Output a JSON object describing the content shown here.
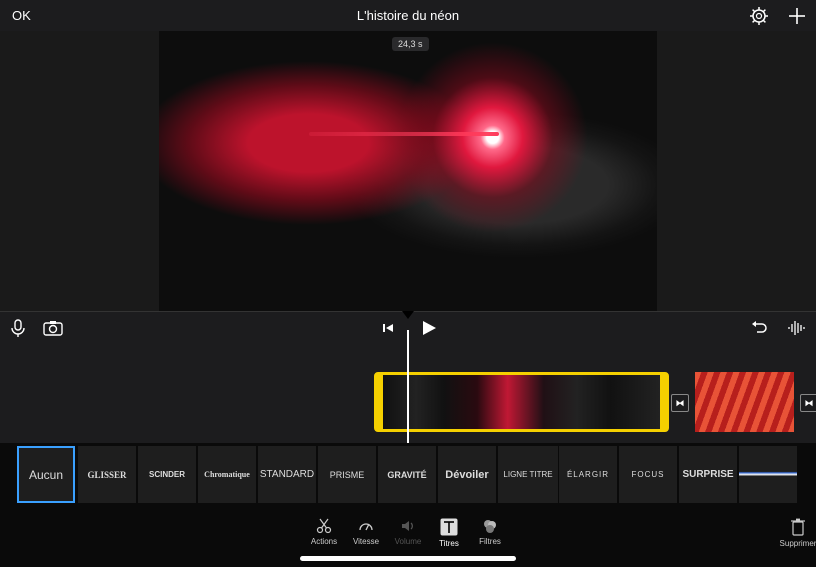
{
  "header": {
    "ok_label": "OK",
    "title": "L'histoire du néon"
  },
  "preview": {
    "duration": "24,3 s"
  },
  "titles": [
    {
      "label": "Aucun",
      "selected": true
    },
    {
      "label": "GLISSER"
    },
    {
      "label": "SCINDER"
    },
    {
      "label": "Chromatique"
    },
    {
      "label": "STANDARD"
    },
    {
      "label": "PRISME"
    },
    {
      "label": "GRAVITÉ"
    },
    {
      "label": "Dévoiler"
    },
    {
      "label": "LIGNE TITRE"
    },
    {
      "label": "ÉLARGIR"
    },
    {
      "label": "FOCUS"
    },
    {
      "label": "SURPRISE"
    },
    {
      "label": ""
    }
  ],
  "toolbar": {
    "actions": "Actions",
    "speed": "Vitesse",
    "volume": "Volume",
    "titles": "Titres",
    "filters": "Filtres",
    "delete": "Supprimer"
  },
  "colors": {
    "selection": "#f5d000",
    "accent": "#3aa0ff"
  }
}
